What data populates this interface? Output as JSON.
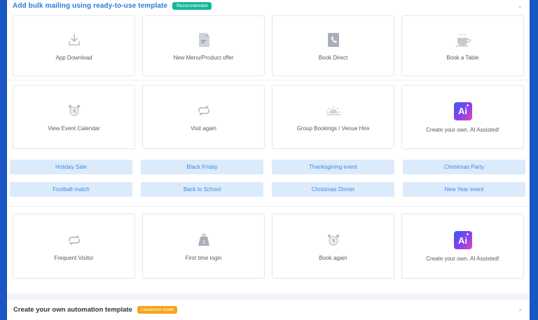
{
  "section1": {
    "title": "Add bulk mailing using ready-to-use template",
    "badge": "Recommended"
  },
  "row1": [
    {
      "label": "App Download",
      "icon": "download-icon"
    },
    {
      "label": "New Menu/Product offer",
      "icon": "document-icon"
    },
    {
      "label": "Book Direct",
      "icon": "phone-book-icon"
    },
    {
      "label": "Book a Table",
      "icon": "coffee-cup-icon"
    }
  ],
  "row2": [
    {
      "label": "View Event Calendar",
      "icon": "alarm-clock-icon"
    },
    {
      "label": "Visit again",
      "icon": "repeat-icon"
    },
    {
      "label": "Group Bookings / Venue Hire",
      "icon": "sunrise-icon"
    },
    {
      "label": "Create your own. AI Assisted!",
      "icon": "ai-icon",
      "icon_text": "Ai"
    }
  ],
  "pills_row1": [
    "Holiday Sale",
    "Black Friday",
    "Thanksgiving event",
    "Christmas Party"
  ],
  "pills_row2": [
    "Football match",
    "Back to School",
    "Christmas Dinner",
    "New Year event"
  ],
  "row3": [
    {
      "label": "Frequent Visitor",
      "icon": "repeat-icon"
    },
    {
      "label": "First time login",
      "icon": "weight-icon",
      "icon_text": "1"
    },
    {
      "label": "Book again",
      "icon": "alarm-clock-icon"
    },
    {
      "label": "Create your own. AI Assisted!",
      "icon": "ai-icon",
      "icon_text": "Ai"
    }
  ],
  "section2": {
    "title": "Create your own automation template",
    "badge": "Advanced mode"
  },
  "colors": {
    "accent": "#2a7ae0",
    "recommended": "#17b79a",
    "advanced": "#f6a417",
    "pill_bg": "#dcebfb",
    "frame": "#1a56c4"
  }
}
